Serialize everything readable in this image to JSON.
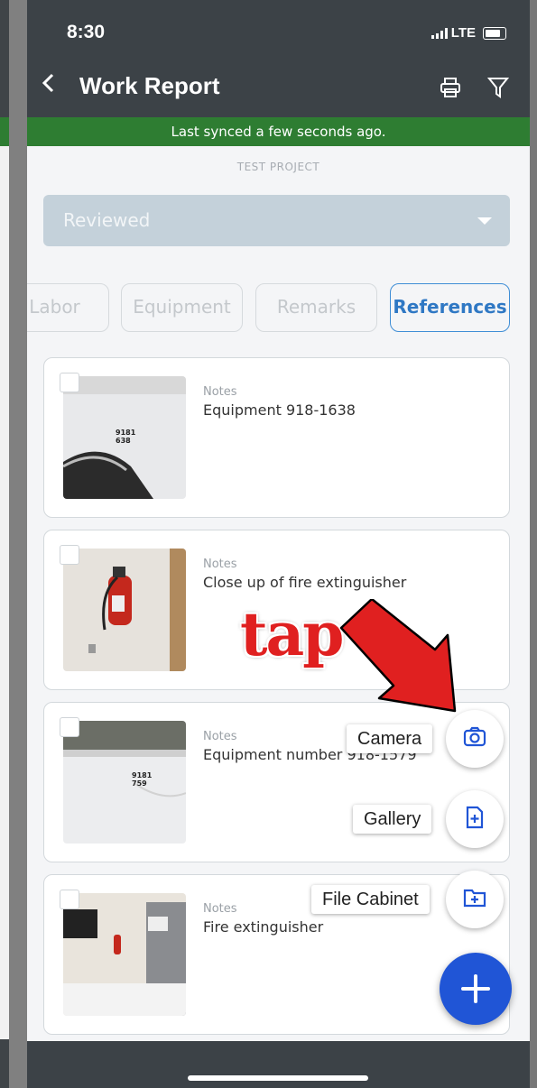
{
  "status_bar": {
    "time": "8:30",
    "network": "LTE"
  },
  "header": {
    "title": "Work Report",
    "back_icon": "chevron-left-icon",
    "print_icon": "printer-icon",
    "filter_icon": "filter-icon"
  },
  "sync_banner": {
    "text": "Last synced a few seconds ago.",
    "color": "#2e7d32"
  },
  "project_name": "TEST PROJECT",
  "status_dropdown": {
    "value": "Reviewed"
  },
  "tabs": [
    {
      "label": "Labor",
      "active": false
    },
    {
      "label": "Equipment",
      "active": false
    },
    {
      "label": "Remarks",
      "active": false
    },
    {
      "label": "References",
      "active": true
    }
  ],
  "references": [
    {
      "label": "Notes",
      "text": "Equipment 918-1638",
      "photo_text": "9181\n638"
    },
    {
      "label": "Notes",
      "text": "Close up of fire extinguisher"
    },
    {
      "label": "Notes",
      "text": "Equipment number 918-1579",
      "photo_text": "9181\n759"
    },
    {
      "label": "Notes",
      "text": "Fire extinguisher"
    }
  ],
  "fab_menu": {
    "camera": "Camera",
    "gallery": "Gallery",
    "file_cabinet": "File Cabinet"
  },
  "annotation": {
    "text": "tap",
    "color": "#e02020"
  },
  "colors": {
    "accent": "#2055d6",
    "header": "#3c4247"
  }
}
